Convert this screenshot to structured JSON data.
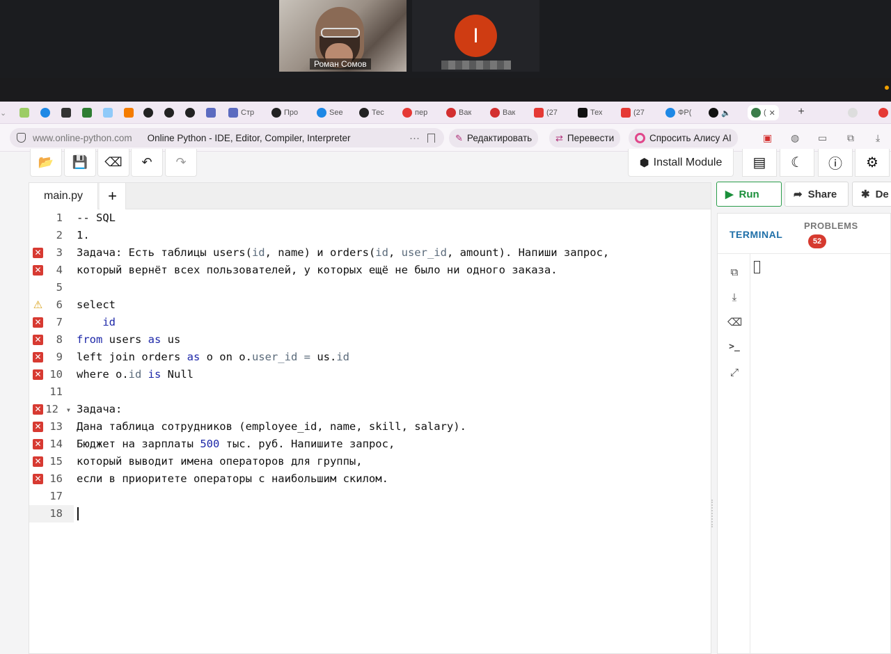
{
  "call": {
    "participants": [
      {
        "name": "Роман Сомов",
        "type": "video"
      },
      {
        "initial": "I",
        "type": "avatar",
        "avatar_color": "#cf3c12"
      }
    ]
  },
  "browser": {
    "tabs": [
      "Стр",
      "Про",
      "See",
      "Тес",
      "пер",
      "Вак",
      "Вак",
      "(27",
      "Тех",
      "(27",
      "ФР("
    ],
    "active_tab": "(",
    "url_host": "www.online-python.com",
    "page_title": "Online Python - IDE, Editor, Compiler, Interpreter",
    "actions": {
      "edit": "Редактировать",
      "translate": "Перевести",
      "alice": "Спросить Алису AI"
    }
  },
  "toolbar": {
    "install_label": "Install Module"
  },
  "editor": {
    "file_tab": "main.py",
    "add_tab": "+",
    "lines": [
      {
        "n": "1",
        "mark": "",
        "text": "-- SQL"
      },
      {
        "n": "2",
        "mark": "",
        "text": "1."
      },
      {
        "n": "3",
        "mark": "error",
        "text": "Задача: Есть таблицы users(id, name) и orders(id, user_id, amount). Напиши запрос,"
      },
      {
        "n": "4",
        "mark": "error",
        "text": "который вернёт всех пользователей, у которых ещё не было ни одного заказа."
      },
      {
        "n": "5",
        "mark": "",
        "text": ""
      },
      {
        "n": "6",
        "mark": "warning",
        "text": "select"
      },
      {
        "n": "7",
        "mark": "error",
        "text": "    id"
      },
      {
        "n": "8",
        "mark": "error",
        "text": "from users as us"
      },
      {
        "n": "9",
        "mark": "error",
        "text": "left join orders as o on o.user_id = us.id"
      },
      {
        "n": "10",
        "mark": "error",
        "text": "where o.id is Null"
      },
      {
        "n": "11",
        "mark": "",
        "text": ""
      },
      {
        "n": "12",
        "mark": "error",
        "text": "Задача:"
      },
      {
        "n": "13",
        "mark": "error",
        "text": "Дана таблица сотрудников (employee_id, name, skill, salary)."
      },
      {
        "n": "14",
        "mark": "error",
        "text": "Бюджет на зарплаты 500 тыс. руб. Напишите запрос,"
      },
      {
        "n": "15",
        "mark": "error",
        "text": "который выводит имена операторов для группы,"
      },
      {
        "n": "16",
        "mark": "error",
        "text": "если в приоритете операторы с наибольшим скилом."
      },
      {
        "n": "17",
        "mark": "",
        "text": ""
      },
      {
        "n": "18",
        "mark": "",
        "text": ""
      }
    ]
  },
  "actions": {
    "run": "Run",
    "share": "Share",
    "debug": "De"
  },
  "terminal": {
    "tab_terminal": "TERMINAL",
    "tab_problems": "PROBLEMS",
    "problems_count": "52"
  },
  "colors": {
    "error": "#d73a32",
    "warning": "#d9a21b",
    "keyword": "#1d27a8",
    "run": "#1a8f3a"
  }
}
